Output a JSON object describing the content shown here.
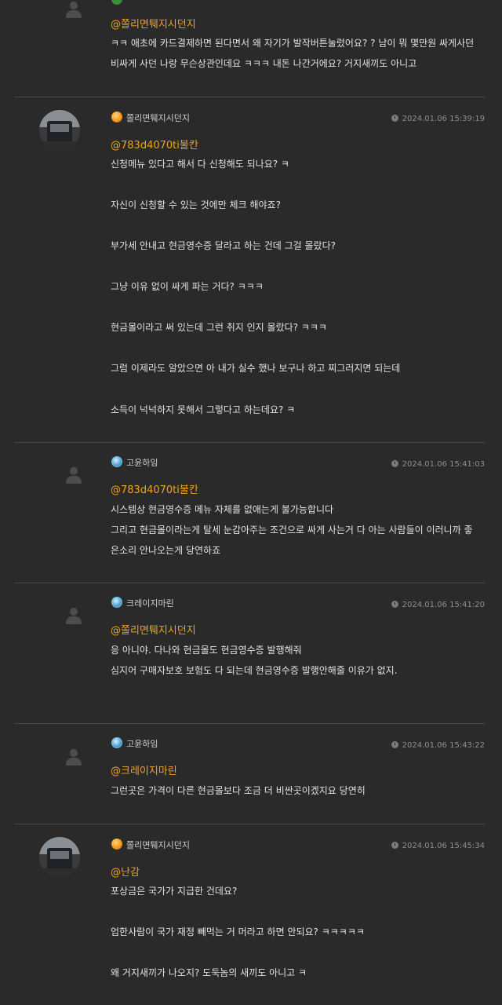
{
  "comments": [
    {
      "id": "c0",
      "nickname": "",
      "level_icon": "green-level-icon",
      "timestamp": "",
      "mention": "@쫄리면퉤지시던지",
      "lines": [
        "ㅋㅋ 애초에 카드결제하면 된다면서 왜 자기가 발작버튼눌렀어요? ? 남이 뭐 몇만원 싸게사던",
        "비싸게 사던 나랑 무슨상관인데요 ㅋㅋㅋ 내돈 나간거에요?  거지새끼도 아니고"
      ]
    },
    {
      "id": "c1",
      "nickname": "쫄리면퉤지시던지",
      "level_icon": "orange-level-icon",
      "timestamp": "2024.01.06 15:39:19",
      "mention": "@783d4070ti불칸",
      "lines": [
        "신청메뉴 있다고 해서 다 신청해도 되나요? ㅋ",
        "",
        "자신이 신청할 수 있는 것에만 체크 해야죠?",
        "",
        "부가세 안내고 현금영수증 달라고 하는 건데 그걸 몰랐다?",
        "",
        "그냥 이유 없이 싸게 파는 거다? ㅋㅋㅋ",
        "",
        "현금몰이라고 써 있는데  그런 취지 인지 몰랐다? ㅋㅋㅋ",
        "",
        "그럼 이제라도 알았으면 아 내가 실수 했나 보구나 하고 찌그러지면 되는데",
        "",
        "소득이 넉넉하지 못해서 그렇다고 하는데요? ㅋ"
      ]
    },
    {
      "id": "c2",
      "nickname": "고윤하임",
      "level_icon": "blue-level-icon",
      "timestamp": "2024.01.06 15:41:03",
      "mention": "@783d4070ti불칸",
      "lines": [
        "시스템상 현금영수증 메뉴 자체를 없애는게 불가능합니다",
        "그리고 현금몰이라는게 탈세 눈감아주는 조건으로 싸게 사는거 다 아는 사람들이 이러니까 좋",
        "은소리 안나오는게 당연하죠"
      ]
    },
    {
      "id": "c3",
      "nickname": "크레이지마린",
      "level_icon": "blue-level-icon",
      "timestamp": "2024.01.06 15:41:20",
      "mention": "@쫄리면퉤지시던지",
      "lines": [
        "응 아니야. 다나와 현금몰도 현금영수증 발행해줘",
        "심지어 구매자보호 보험도 다 되는데 현금영수증 발행안해줄 이유가 없지."
      ]
    },
    {
      "id": "c4",
      "nickname": "고윤하임",
      "level_icon": "blue-level-icon",
      "timestamp": "2024.01.06 15:43:22",
      "mention": "@크레이지마린",
      "lines": [
        "그런곳은 가격이 다른 현금몰보다 조금 더 비싼곳이겠지요 당연히"
      ]
    },
    {
      "id": "c5",
      "nickname": "쫄리면퉤지시던지",
      "level_icon": "orange-level-icon",
      "timestamp": "2024.01.06 15:45:34",
      "mention": "@난감",
      "lines": [
        "포상금은 국가가 지급한 건데요?",
        "",
        "엄한사람이 국가 재정 빼먹는 거 머라고 하면 안되요? ㅋㅋㅋㅋㅋ",
        "",
        "왜 거지새끼가 나오지?  도둑놈의 새끼도 아니고 ㅋ"
      ]
    }
  ]
}
